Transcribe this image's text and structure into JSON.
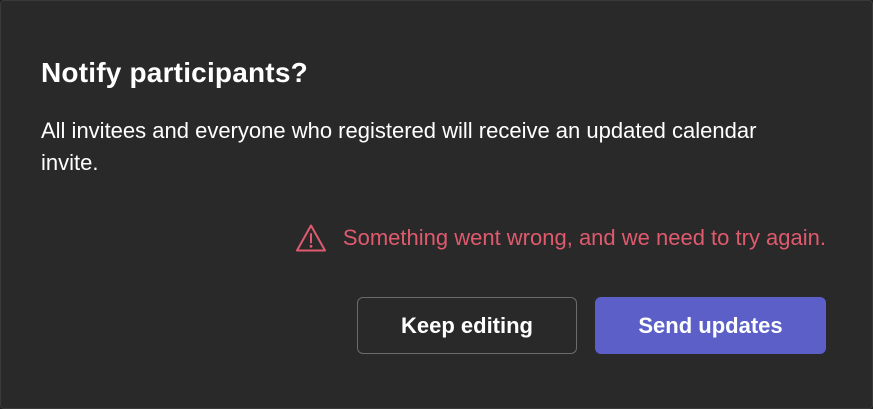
{
  "dialog": {
    "title": "Notify participants?",
    "message": "All invitees and everyone who registered will receive an updated calendar invite.",
    "error": {
      "icon": "warning-triangle-icon",
      "text": "Something went wrong, and we need to try again.",
      "color": "#e05a6e"
    },
    "buttons": {
      "keep_editing_label": "Keep editing",
      "send_updates_label": "Send updates"
    },
    "colors": {
      "background": "#292929",
      "primary_button": "#5b5fc7",
      "text": "#ffffff"
    }
  }
}
